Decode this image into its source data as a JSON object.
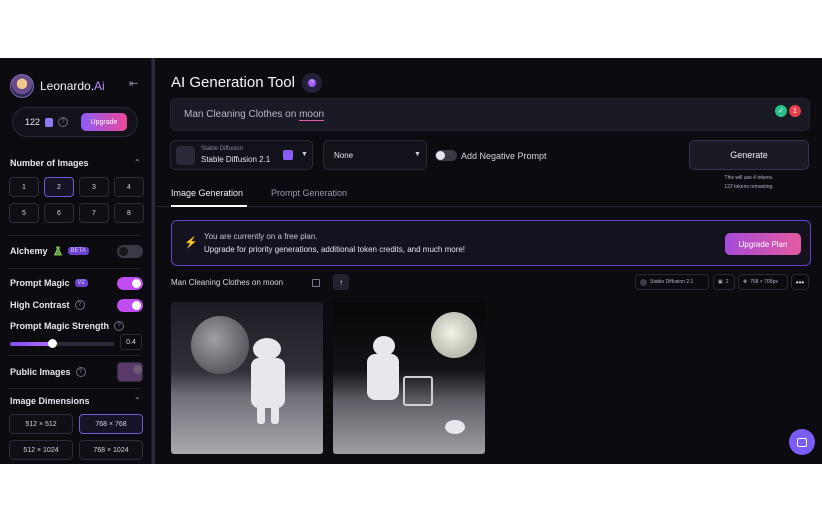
{
  "brand": {
    "name": "Leonardo.",
    "suffix": "Ai"
  },
  "tokens": {
    "count": "122",
    "upgrade_label": "Upgrade"
  },
  "sidebar": {
    "num_images": {
      "title": "Number of Images",
      "options": [
        "1",
        "2",
        "3",
        "4",
        "5",
        "6",
        "7",
        "8"
      ],
      "selected": "2"
    },
    "alchemy": {
      "label": "Alchemy",
      "badge": "BETA",
      "enabled": false
    },
    "prompt_magic": {
      "label": "Prompt Magic",
      "badge": "V2",
      "enabled": true
    },
    "high_contrast": {
      "label": "High Contrast",
      "enabled": true
    },
    "prompt_magic_strength": {
      "label": "Prompt Magic Strength",
      "value": "0.4",
      "fraction": 0.4
    },
    "public_images": {
      "label": "Public Images",
      "enabled": true
    },
    "image_dimensions": {
      "title": "Image Dimensions",
      "options": [
        "512 × 512",
        "768 × 768",
        "512 × 1024",
        "768 × 1024"
      ],
      "selected": "768 × 768"
    }
  },
  "main": {
    "title": "AI Generation Tool",
    "prompt": {
      "text_before": "Man Cleaning Clothes on ",
      "text_underlined": "moon",
      "badge_count": "1"
    },
    "model": {
      "subtitle": "Stable Diffusion",
      "name": "Stable Diffusion 2.1"
    },
    "style": {
      "value": "None"
    },
    "negative_prompt": {
      "label": "Add Negative Prompt",
      "enabled": false
    },
    "generate": {
      "label": "Generate",
      "note_line1": "This will use 4 tokens.",
      "note_line2": "122 tokens remaining."
    },
    "tabs": [
      {
        "label": "Image Generation",
        "active": true
      },
      {
        "label": "Prompt Generation",
        "active": false
      }
    ],
    "notice": {
      "line1": "You are currently on a free plan.",
      "line2": "Upgrade for priority generations, additional token credits, and much more!",
      "button": "Upgrade Plan"
    },
    "job": {
      "title": "Man Cleaning Clothes on moon",
      "model": "Stable Diffusion 2.1",
      "count": "2",
      "size": "768 × 768px"
    }
  },
  "colors": {
    "accent": "#8b5cf6",
    "pink": "#e45aa1",
    "background": "#0b0b10"
  }
}
